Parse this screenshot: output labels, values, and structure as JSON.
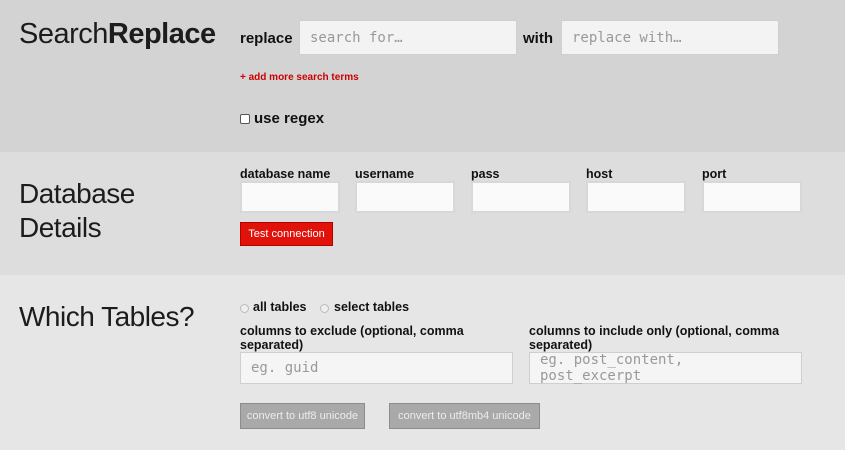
{
  "search_section": {
    "title_light": "Search",
    "title_bold": "Replace",
    "replace_label": "replace",
    "search_placeholder": "search for…",
    "with_label": "with",
    "replace_placeholder": "replace with…",
    "add_terms_link": "+ add more search terms",
    "use_regex_label": "use regex",
    "use_regex_checked": false
  },
  "database_section": {
    "title_line1": "Database",
    "title_line2": "Details",
    "fields": [
      {
        "label": "database name",
        "value": ""
      },
      {
        "label": "username",
        "value": ""
      },
      {
        "label": "pass",
        "value": ""
      },
      {
        "label": "host",
        "value": ""
      },
      {
        "label": "port",
        "value": ""
      }
    ],
    "test_button": "Test connection"
  },
  "tables_section": {
    "title": "Which Tables?",
    "radio_all": "all tables",
    "radio_select": "select tables",
    "selected": "all tables",
    "exclude_label": "columns to exclude (optional, comma separated)",
    "exclude_placeholder": "eg. guid",
    "include_label": "columns to include only (optional, comma separated)",
    "include_placeholder": "eg. post_content, post_excerpt",
    "utf8_button": "convert to utf8 unicode",
    "utf8mb4_button": "convert to utf8mb4 unicode"
  },
  "colors": {
    "accent_red": "#e0120a",
    "link_red": "#cc0000",
    "disabled_button": "#a9a9a9"
  }
}
